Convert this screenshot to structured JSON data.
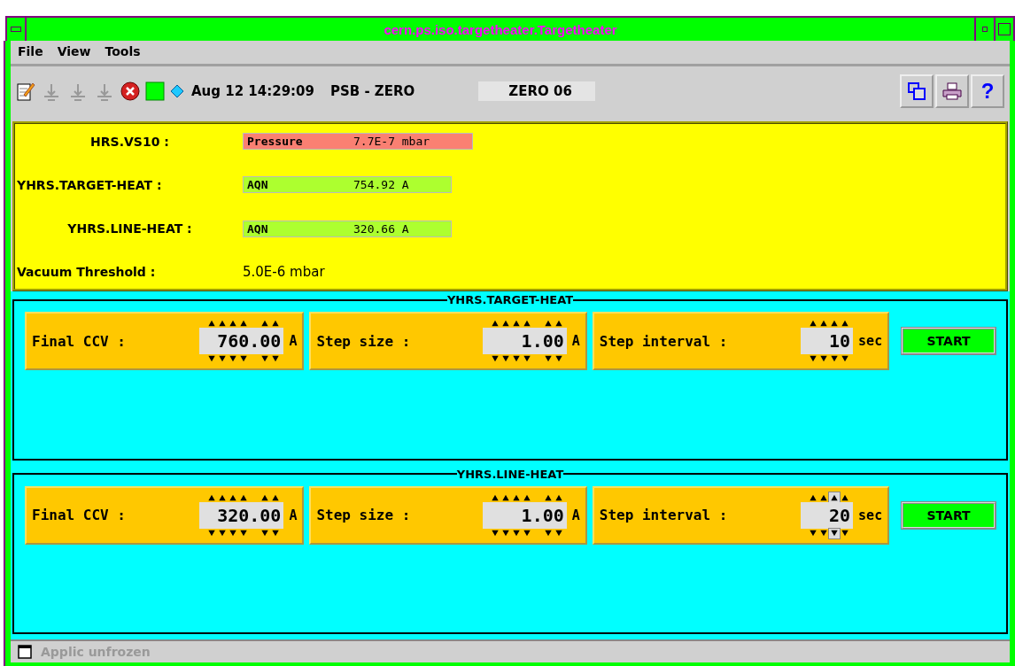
{
  "window": {
    "title": "cern.ps.iso.targetheater.Targetheater"
  },
  "menu": [
    "File",
    "View",
    "Tools"
  ],
  "toolbar": {
    "tools": [
      {
        "kind": "edit",
        "disabled": false
      },
      {
        "kind": "tool",
        "disabled": true
      },
      {
        "kind": "tool",
        "disabled": true
      },
      {
        "kind": "tool",
        "disabled": true
      },
      {
        "kind": "error",
        "disabled": false
      },
      {
        "kind": "square",
        "disabled": false
      },
      {
        "kind": "diamond",
        "disabled": false
      }
    ],
    "timestamp": "Aug 12 14:29:09",
    "context": "PSB - ZERO",
    "user": "ZERO 06",
    "help": "?"
  },
  "readings": [
    {
      "kind": "readout",
      "label": "HRS.VS10 :",
      "name": "Pressure",
      "value": "7.7E-7 mbar",
      "color": "#fa8072"
    },
    {
      "kind": "readout",
      "label": "YHRS.TARGET-HEAT :",
      "name": "AQN",
      "value": "754.92 A",
      "color": "#adff2f"
    },
    {
      "kind": "readout",
      "label": "YHRS.LINE-HEAT :",
      "name": "AQN",
      "value": "320.66 A",
      "color": "#adff2f"
    },
    {
      "kind": "value",
      "label": "Vacuum Threshold :",
      "value": "5.0E-6 mbar"
    }
  ],
  "groups": [
    {
      "title": "YHRS.TARGET-HEAT",
      "controls": [
        {
          "label": "Final CCV :",
          "value": "760.00",
          "unit": "A",
          "focused": false
        },
        {
          "label": "Step size :",
          "value": "1.00",
          "unit": "A",
          "focused": false
        },
        {
          "label": "Step interval :",
          "value": "10",
          "unit": "sec",
          "focused": false
        }
      ],
      "button": "START"
    },
    {
      "title": "YHRS.LINE-HEAT",
      "controls": [
        {
          "label": "Final CCV :",
          "value": "320.00",
          "unit": "A",
          "focused": false
        },
        {
          "label": "Step size :",
          "value": "1.00",
          "unit": "A",
          "focused": false
        },
        {
          "label": "Step interval :",
          "value": "20",
          "unit": "sec",
          "focused": true
        }
      ],
      "button": "START"
    }
  ],
  "status_bar": {
    "text": "Applic unfrozen",
    "disabled": true
  }
}
